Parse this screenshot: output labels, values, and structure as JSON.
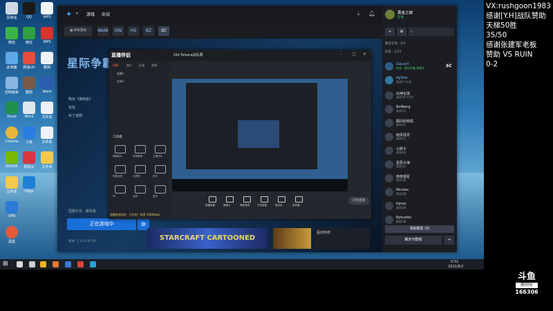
{
  "overlay": {
    "lines": [
      "VX:rushgoon1983",
      "感谢[Y.H]战队赞助",
      "天梯50胜",
      "35/50",
      "感谢张建军老板",
      "赞助 VS RUIN",
      "0-2"
    ]
  },
  "room_logo": {
    "brand": "斗鱼",
    "label": "房间号",
    "room_number": "166306"
  },
  "client": {
    "nav": [
      "游戏",
      "商城"
    ],
    "games": [
      "WoW",
      "OW",
      "HS",
      "BZ",
      "SC"
    ],
    "active_game_title": "星际争霸",
    "links": [
      "购买《游戏名》",
      "论坛",
      "补丁说明"
    ],
    "region_label": "国服华东 · 繁体版",
    "play_button": "正在游戏中",
    "version": "版本: 1.23.9.9719",
    "banner_main": "STARCRAFT CARTOONED",
    "banner_news": "驱动传统"
  },
  "friends": {
    "user_name": "黄金之城",
    "user_status": "在线",
    "section_recent": "最近在线 · 0/3",
    "section_friends": "好友 · 2/23",
    "items": [
      {
        "name": "GaLeeY",
        "status": "在线 · 星际争霸 游戏中"
      },
      {
        "name": "AgStar",
        "status": "离线2个小时"
      },
      {
        "name": "出神化境",
        "status": "离线16个小时"
      },
      {
        "name": "BoWang",
        "status": "离线1天"
      },
      {
        "name": "瞬间的热情",
        "status": "离线1天"
      },
      {
        "name": "晓风残月",
        "status": "离线2天"
      },
      {
        "name": "小胖子",
        "status": "离线4天"
      },
      {
        "name": "星辰大海",
        "status": "离线5天"
      },
      {
        "name": "雨夜孤星",
        "status": "离线1周"
      },
      {
        "name": "Nicolas",
        "status": "离线1周"
      },
      {
        "name": "tigran",
        "status": "离线2周"
      },
      {
        "name": "Bybuster",
        "status": "离线3周"
      }
    ],
    "add_button": "添加朋友 (3)",
    "chat_button": "聊天与群组"
  },
  "recorder": {
    "app_name": "直播伴侣",
    "scene_tabs": [
      "场景",
      "图片",
      "区域",
      "视频"
    ],
    "scenes": [
      "场景1",
      "文本1"
    ],
    "tools_title": "工具箱",
    "tools": [
      "弹幕助手",
      "房管管理",
      "主播任务",
      "视频连麦",
      "礼物榜",
      "音乐",
      "PK",
      "抽奖",
      "更多"
    ],
    "stream_title": "Old Telsara战队赛",
    "controls": [
      "直播设置",
      "摄像头",
      "美颜滤镜",
      "手机直播",
      "麦克风",
      "扬声器"
    ],
    "go_live": "开始直播",
    "status_text": "直播状态良好 · 已开启 · 码率 3000kbps"
  },
  "taskbar": {
    "time": "0:52",
    "date": "2021/6/2"
  },
  "desktop_icons": [
    "回收站",
    "QQ",
    "WPS",
    "微信",
    "此电脑",
    "网易UU",
    "控制面板",
    "酷狗",
    "Excel",
    "Chrome",
    "斗鱼",
    "NVIDIA",
    "网易云",
    "Edge",
    "Word",
    "文件夹",
    "黑盒",
    "VPN"
  ]
}
